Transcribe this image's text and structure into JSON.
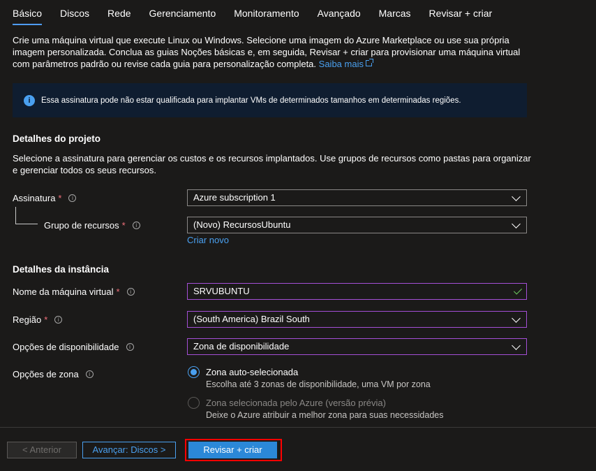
{
  "tabs": [
    {
      "label": "Básico",
      "active": true
    },
    {
      "label": "Discos"
    },
    {
      "label": "Rede"
    },
    {
      "label": "Gerenciamento"
    },
    {
      "label": "Monitoramento"
    },
    {
      "label": "Avançado"
    },
    {
      "label": "Marcas"
    },
    {
      "label": "Revisar + criar"
    }
  ],
  "intro": {
    "text": "Crie uma máquina virtual que execute Linux ou Windows. Selecione uma imagem do Azure Marketplace ou use sua própria imagem personalizada. Conclua as guias Noções básicas e, em seguida, Revisar + criar para provisionar uma máquina virtual com parâmetros padrão ou revise cada guia para personalização completa.",
    "link": "Saiba mais"
  },
  "banner": {
    "icon": "info-icon",
    "text": "Essa assinatura pode não estar qualificada para implantar VMs de determinados tamanhos em determinadas regiões."
  },
  "project": {
    "title": "Detalhes do projeto",
    "description": "Selecione a assinatura para gerenciar os custos e os recursos implantados. Use grupos de recursos como pastas para organizar e gerenciar todos os seus recursos.",
    "subscription_label": "Assinatura",
    "subscription_value": "Azure subscription 1",
    "resource_group_label": "Grupo de recursos",
    "resource_group_value": "(Novo) RecursosUbuntu",
    "create_new": "Criar novo"
  },
  "instance": {
    "title": "Detalhes da instância",
    "vm_name_label": "Nome da máquina virtual",
    "vm_name_value": "SRVUBUNTU",
    "region_label": "Região",
    "region_value": "(South America) Brazil South",
    "availability_label": "Opções de disponibilidade",
    "availability_value": "Zona de disponibilidade",
    "zone_label": "Opções de zona",
    "zone_options": [
      {
        "label": "Zona auto-selecionada",
        "sub": "Escolha até 3 zonas de disponibilidade, uma VM por zona",
        "checked": true
      },
      {
        "label": "Zona selecionada pelo Azure (versão prévia)",
        "sub": "Deixe o Azure atribuir a melhor zona para suas necessidades",
        "disabled": true
      }
    ]
  },
  "footer": {
    "prev": "< Anterior",
    "next": "Avançar: Discos >",
    "review": "Revisar + criar"
  },
  "colors": {
    "accent": "#4aa0f0",
    "required": "#f1707b",
    "valid": "#6ccb5f",
    "highlight": "#ff0000"
  }
}
